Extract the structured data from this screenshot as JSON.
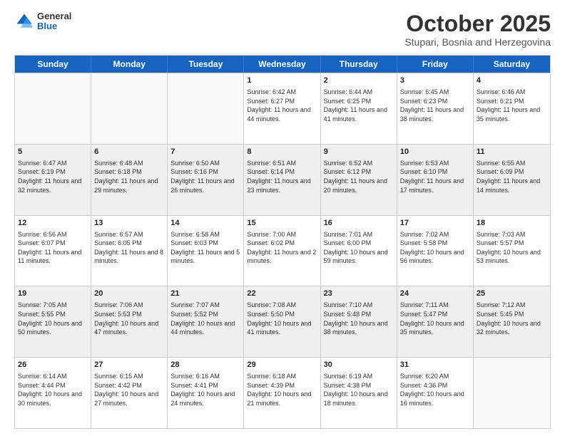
{
  "header": {
    "logo": {
      "general": "General",
      "blue": "Blue"
    },
    "title": "October 2025",
    "subtitle": "Stupari, Bosnia and Herzegovina"
  },
  "days_of_week": [
    "Sunday",
    "Monday",
    "Tuesday",
    "Wednesday",
    "Thursday",
    "Friday",
    "Saturday"
  ],
  "weeks": [
    [
      {
        "day": "",
        "info": "",
        "empty": true
      },
      {
        "day": "",
        "info": "",
        "empty": true
      },
      {
        "day": "",
        "info": "",
        "empty": true
      },
      {
        "day": "1",
        "info": "Sunrise: 6:42 AM\nSunset: 6:27 PM\nDaylight: 11 hours\nand 44 minutes."
      },
      {
        "day": "2",
        "info": "Sunrise: 6:44 AM\nSunset: 6:25 PM\nDaylight: 11 hours\nand 41 minutes."
      },
      {
        "day": "3",
        "info": "Sunrise: 6:45 AM\nSunset: 6:23 PM\nDaylight: 11 hours\nand 38 minutes."
      },
      {
        "day": "4",
        "info": "Sunrise: 6:46 AM\nSunset: 6:21 PM\nDaylight: 11 hours\nand 35 minutes."
      }
    ],
    [
      {
        "day": "5",
        "info": "Sunrise: 6:47 AM\nSunset: 6:19 PM\nDaylight: 11 hours\nand 32 minutes.",
        "shaded": true
      },
      {
        "day": "6",
        "info": "Sunrise: 6:48 AM\nSunset: 6:18 PM\nDaylight: 11 hours\nand 29 minutes.",
        "shaded": true
      },
      {
        "day": "7",
        "info": "Sunrise: 6:50 AM\nSunset: 6:16 PM\nDaylight: 11 hours\nand 26 minutes.",
        "shaded": true
      },
      {
        "day": "8",
        "info": "Sunrise: 6:51 AM\nSunset: 6:14 PM\nDaylight: 11 hours\nand 23 minutes.",
        "shaded": true
      },
      {
        "day": "9",
        "info": "Sunrise: 6:52 AM\nSunset: 6:12 PM\nDaylight: 11 hours\nand 20 minutes.",
        "shaded": true
      },
      {
        "day": "10",
        "info": "Sunrise: 6:53 AM\nSunset: 6:10 PM\nDaylight: 11 hours\nand 17 minutes.",
        "shaded": true
      },
      {
        "day": "11",
        "info": "Sunrise: 6:55 AM\nSunset: 6:09 PM\nDaylight: 11 hours\nand 14 minutes.",
        "shaded": true
      }
    ],
    [
      {
        "day": "12",
        "info": "Sunrise: 6:56 AM\nSunset: 6:07 PM\nDaylight: 11 hours\nand 11 minutes."
      },
      {
        "day": "13",
        "info": "Sunrise: 6:57 AM\nSunset: 6:05 PM\nDaylight: 11 hours\nand 8 minutes."
      },
      {
        "day": "14",
        "info": "Sunrise: 6:58 AM\nSunset: 6:03 PM\nDaylight: 11 hours\nand 5 minutes."
      },
      {
        "day": "15",
        "info": "Sunrise: 7:00 AM\nSunset: 6:02 PM\nDaylight: 11 hours\nand 2 minutes."
      },
      {
        "day": "16",
        "info": "Sunrise: 7:01 AM\nSunset: 6:00 PM\nDaylight: 10 hours\nand 59 minutes."
      },
      {
        "day": "17",
        "info": "Sunrise: 7:02 AM\nSunset: 5:58 PM\nDaylight: 10 hours\nand 56 minutes."
      },
      {
        "day": "18",
        "info": "Sunrise: 7:03 AM\nSunset: 5:57 PM\nDaylight: 10 hours\nand 53 minutes."
      }
    ],
    [
      {
        "day": "19",
        "info": "Sunrise: 7:05 AM\nSunset: 5:55 PM\nDaylight: 10 hours\nand 50 minutes.",
        "shaded": true
      },
      {
        "day": "20",
        "info": "Sunrise: 7:06 AM\nSunset: 5:53 PM\nDaylight: 10 hours\nand 47 minutes.",
        "shaded": true
      },
      {
        "day": "21",
        "info": "Sunrise: 7:07 AM\nSunset: 5:52 PM\nDaylight: 10 hours\nand 44 minutes.",
        "shaded": true
      },
      {
        "day": "22",
        "info": "Sunrise: 7:08 AM\nSunset: 5:50 PM\nDaylight: 10 hours\nand 41 minutes.",
        "shaded": true
      },
      {
        "day": "23",
        "info": "Sunrise: 7:10 AM\nSunset: 5:48 PM\nDaylight: 10 hours\nand 38 minutes.",
        "shaded": true
      },
      {
        "day": "24",
        "info": "Sunrise: 7:11 AM\nSunset: 5:47 PM\nDaylight: 10 hours\nand 35 minutes.",
        "shaded": true
      },
      {
        "day": "25",
        "info": "Sunrise: 7:12 AM\nSunset: 5:45 PM\nDaylight: 10 hours\nand 32 minutes.",
        "shaded": true
      }
    ],
    [
      {
        "day": "26",
        "info": "Sunrise: 6:14 AM\nSunset: 4:44 PM\nDaylight: 10 hours\nand 30 minutes."
      },
      {
        "day": "27",
        "info": "Sunrise: 6:15 AM\nSunset: 4:42 PM\nDaylight: 10 hours\nand 27 minutes."
      },
      {
        "day": "28",
        "info": "Sunrise: 6:16 AM\nSunset: 4:41 PM\nDaylight: 10 hours\nand 24 minutes."
      },
      {
        "day": "29",
        "info": "Sunrise: 6:18 AM\nSunset: 4:39 PM\nDaylight: 10 hours\nand 21 minutes."
      },
      {
        "day": "30",
        "info": "Sunrise: 6:19 AM\nSunset: 4:38 PM\nDaylight: 10 hours\nand 18 minutes."
      },
      {
        "day": "31",
        "info": "Sunrise: 6:20 AM\nSunset: 4:36 PM\nDaylight: 10 hours\nand 16 minutes."
      },
      {
        "day": "",
        "info": "",
        "empty": true
      }
    ]
  ]
}
